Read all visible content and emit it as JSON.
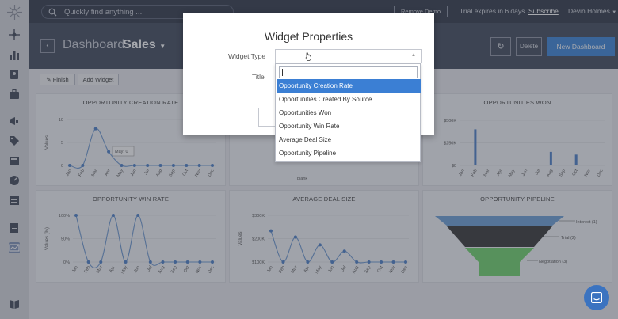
{
  "topbar": {
    "search_placeholder": "Quickly find anything ...",
    "demo_button": "Remove Demo Data",
    "trial_text": "Trial expires in 6 days",
    "subscribe_link": "Subscribe",
    "user_name": "Devin Holmes"
  },
  "header": {
    "title": "Dashboard",
    "subtitle": "Sales",
    "refresh_icon": "↻",
    "delete_button": "Delete",
    "new_button": "New Dashboard",
    "back_icon": "‹"
  },
  "toolbar": {
    "finish_button": "Finish",
    "add_widget_button": "Add Widget"
  },
  "sidebar": {
    "icons": [
      "logo-icon",
      "sitemap-icon",
      "bar-chart-icon",
      "contacts-icon",
      "briefcase-icon",
      "megaphone-icon",
      "tag-icon",
      "inbox-icon",
      "gauge-icon",
      "calendar-icon",
      "document-icon",
      "dashboard-icon",
      "book-icon"
    ]
  },
  "months": [
    "Jan",
    "Feb",
    "Mar",
    "Apr",
    "May",
    "Jun",
    "Jul",
    "Aug",
    "Sep",
    "Oct",
    "Nov",
    "Dec"
  ],
  "widgets": {
    "creation_rate": {
      "title": "OPPORTUNITY CREATION RATE",
      "ylabel": "Values",
      "yticks": [
        "10",
        "5",
        "0"
      ],
      "tooltip": "May: 0"
    },
    "middle_top": {
      "label": "blank"
    },
    "won": {
      "title": "OPPORTUNITIES WON",
      "yticks": [
        "$500K",
        "$250K",
        "$0"
      ]
    },
    "win_rate": {
      "title": "OPPORTUNITY WIN RATE",
      "ylabel": "Values (%)",
      "yticks": [
        "100%",
        "50%",
        "0%"
      ]
    },
    "deal_size": {
      "title": "AVERAGE DEAL SIZE",
      "ylabel": "Values",
      "yticks": [
        "$300K",
        "$200K",
        "$100K"
      ]
    },
    "pipeline": {
      "title": "OPPORTUNITY PIPELINE",
      "labels": [
        "Interest (1)",
        "Trial (2)",
        "Negotiation (3)"
      ],
      "colors": [
        "#6a9fd8",
        "#333333",
        "#6ed36a"
      ]
    }
  },
  "chart_data": [
    {
      "type": "line",
      "title": "OPPORTUNITY CREATION RATE",
      "ylabel": "Values",
      "categories": [
        "Jan",
        "Feb",
        "Mar",
        "Apr",
        "May",
        "Jun",
        "Jul",
        "Aug",
        "Sep",
        "Oct",
        "Nov",
        "Dec"
      ],
      "values": [
        0,
        0,
        8,
        3,
        0,
        0,
        0,
        0,
        0,
        0,
        0,
        0
      ],
      "ylim": [
        0,
        10
      ]
    },
    {
      "type": "bar",
      "title": "OPPORTUNITIES WON",
      "categories": [
        "Jan",
        "Feb",
        "Mar",
        "Apr",
        "May",
        "Jun",
        "Jul",
        "Aug",
        "Sep",
        "Oct",
        "Nov",
        "Dec"
      ],
      "values": [
        0,
        400000,
        0,
        0,
        0,
        0,
        0,
        150000,
        0,
        120000,
        0,
        0
      ],
      "ylim": [
        0,
        500000
      ]
    },
    {
      "type": "line",
      "title": "OPPORTUNITY WIN RATE",
      "ylabel": "Values (%)",
      "categories": [
        "Jan",
        "Feb",
        "Mar",
        "Apr",
        "May",
        "Jun",
        "Jul",
        "Aug",
        "Sep",
        "Oct",
        "Nov",
        "Dec"
      ],
      "values": [
        100,
        0,
        0,
        100,
        0,
        100,
        0,
        0,
        0,
        0,
        0,
        0
      ],
      "ylim": [
        0,
        100
      ]
    },
    {
      "type": "line",
      "title": "AVERAGE DEAL SIZE",
      "ylabel": "Values",
      "categories": [
        "Jan",
        "Feb",
        "Mar",
        "Apr",
        "May",
        "Jun",
        "Jul",
        "Aug",
        "Sep",
        "Oct",
        "Nov",
        "Dec"
      ],
      "values": [
        200000,
        0,
        160000,
        0,
        110000,
        0,
        70000,
        0,
        0,
        0,
        0,
        0
      ],
      "ylim": [
        0,
        300000
      ]
    }
  ],
  "modal": {
    "title": "Widget Properties",
    "type_label": "Widget Type",
    "title_label": "Title",
    "options": [
      "Opportunity Creation Rate",
      "Opportunities Created By Source",
      "Opportunities Won",
      "Opportunity Win Rate",
      "Average Deal Size",
      "Opportunity Pipeline"
    ],
    "selected_index": 0
  }
}
